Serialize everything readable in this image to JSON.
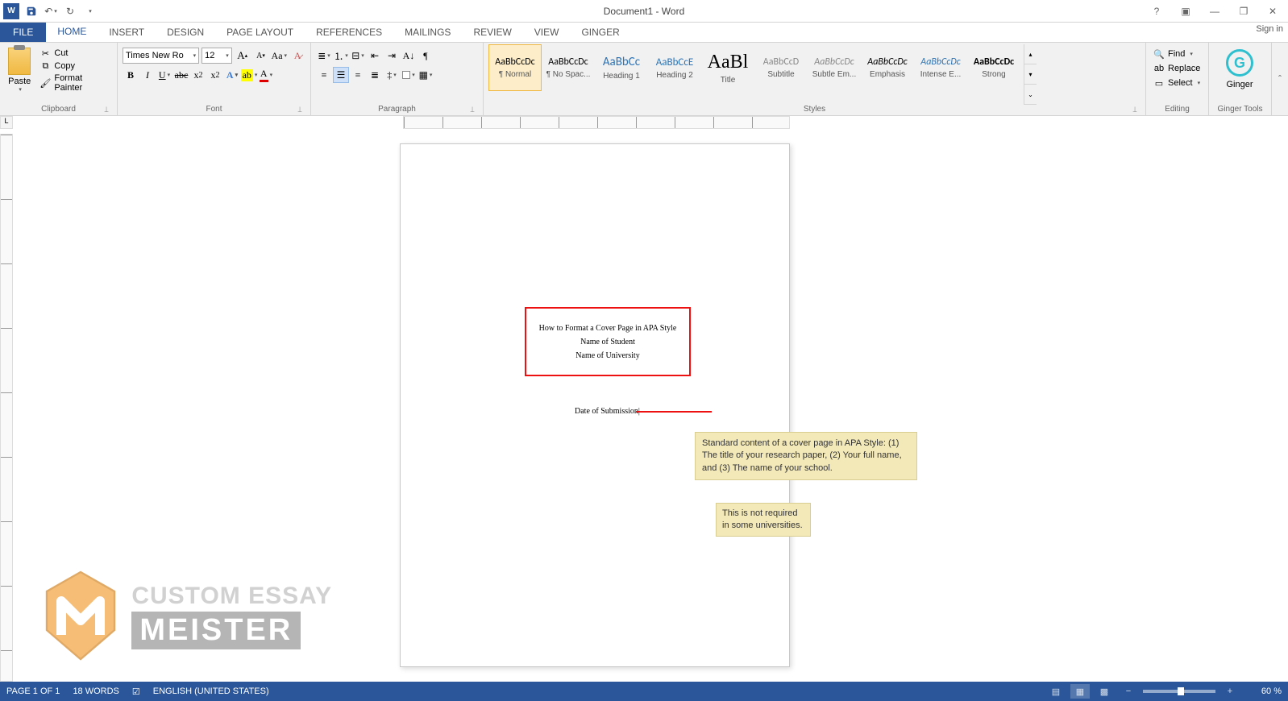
{
  "titlebar": {
    "title": "Document1 - Word",
    "sign_in": "Sign in"
  },
  "tabs": {
    "file": "FILE",
    "home": "HOME",
    "insert": "INSERT",
    "design": "DESIGN",
    "page_layout": "PAGE LAYOUT",
    "references": "REFERENCES",
    "mailings": "MAILINGS",
    "review": "REVIEW",
    "view": "VIEW",
    "ginger": "GINGER"
  },
  "clipboard": {
    "paste": "Paste",
    "cut": "Cut",
    "copy": "Copy",
    "format_painter": "Format Painter",
    "label": "Clipboard"
  },
  "font": {
    "name": "Times New Ro",
    "size": "12",
    "label": "Font"
  },
  "paragraph": {
    "label": "Paragraph"
  },
  "styles": {
    "label": "Styles",
    "items": [
      {
        "preview": "AaBbCcDc",
        "name": "¶ Normal",
        "previewStyle": "font-family:Calibri;font-size:12px;"
      },
      {
        "preview": "AaBbCcDc",
        "name": "¶ No Spac...",
        "previewStyle": "font-family:Calibri;font-size:12px;"
      },
      {
        "preview": "AaBbCc",
        "name": "Heading 1",
        "previewStyle": "font-family:Calibri;font-size:15px;color:#2e74b5;"
      },
      {
        "preview": "AaBbCcE",
        "name": "Heading 2",
        "previewStyle": "font-family:Calibri;font-size:13px;color:#2e74b5;"
      },
      {
        "preview": "AaBl",
        "name": "Title",
        "previewStyle": "font-family:Calibri Light;font-size:24px;"
      },
      {
        "preview": "AaBbCcD",
        "name": "Subtitle",
        "previewStyle": "font-family:Calibri;font-size:12px;color:#888;"
      },
      {
        "preview": "AaBbCcDc",
        "name": "Subtle Em...",
        "previewStyle": "font-family:Calibri;font-size:12px;font-style:italic;color:#888;"
      },
      {
        "preview": "AaBbCcDc",
        "name": "Emphasis",
        "previewStyle": "font-family:Calibri;font-size:12px;font-style:italic;"
      },
      {
        "preview": "AaBbCcDc",
        "name": "Intense E...",
        "previewStyle": "font-family:Calibri;font-size:12px;font-style:italic;color:#2e74b5;"
      },
      {
        "preview": "AaBbCcDc",
        "name": "Strong",
        "previewStyle": "font-family:Calibri;font-size:12px;font-weight:bold;"
      }
    ]
  },
  "editing": {
    "find": "Find",
    "replace": "Replace",
    "select": "Select",
    "label": "Editing"
  },
  "ginger": {
    "btn": "Ginger",
    "label": "Ginger Tools"
  },
  "document": {
    "line1": "How to Format a Cover Page in APA Style",
    "line2": "Name of Student",
    "line3": "Name of University",
    "date": "Date of Submission"
  },
  "comments": {
    "c1": "Standard content of a cover page in APA Style: (1) The title of your research paper, (2) Your full name, and (3) The name of your school.",
    "c2": "This is not required in some universities."
  },
  "watermark": {
    "line1": "CUSTOM ESSAY",
    "line2": "MEISTER"
  },
  "statusbar": {
    "page": "PAGE 1 OF 1",
    "words": "18 WORDS",
    "lang": "ENGLISH (UNITED STATES)",
    "zoom": "60 %"
  }
}
